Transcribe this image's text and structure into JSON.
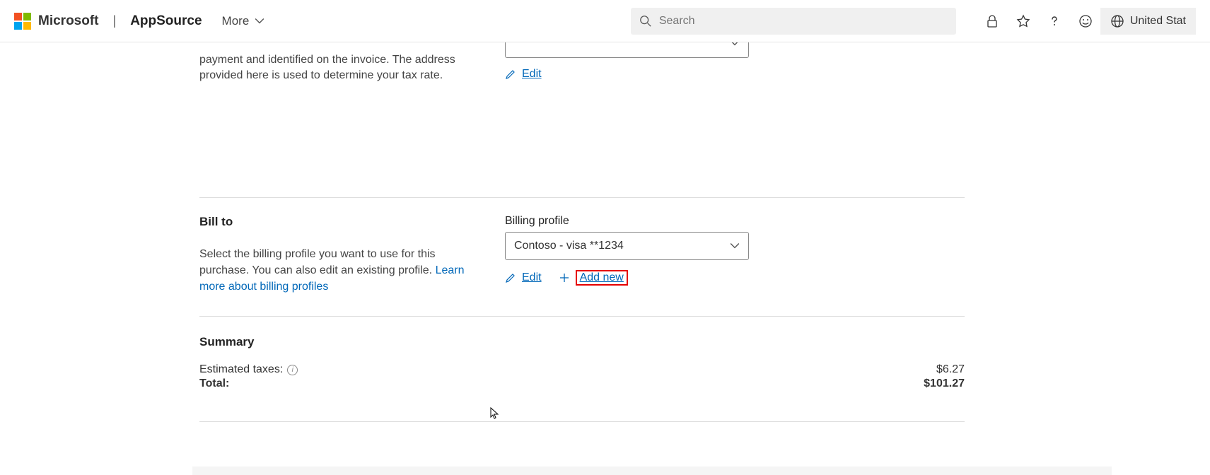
{
  "header": {
    "brand": "Microsoft",
    "app": "AppSource",
    "more": "More",
    "search_placeholder": "Search",
    "region": "United Stat"
  },
  "soldto": {
    "description": "payment and identified on the invoice. The address provided here is used to determine your tax rate.",
    "dropdown_value": "",
    "edit": "Edit"
  },
  "billto": {
    "title": "Bill to",
    "description": "Select the billing profile you want to use for this purchase. You can also edit an existing profile. ",
    "learn_more": "Learn more about billing profiles",
    "field_label": "Billing profile",
    "dropdown_value": "Contoso - visa **1234",
    "edit": "Edit",
    "add_new": "Add new"
  },
  "summary": {
    "title": "Summary",
    "estimated_taxes_label": "Estimated taxes:",
    "estimated_taxes_value": "$6.27",
    "total_label": "Total:",
    "total_value": "$101.27"
  }
}
